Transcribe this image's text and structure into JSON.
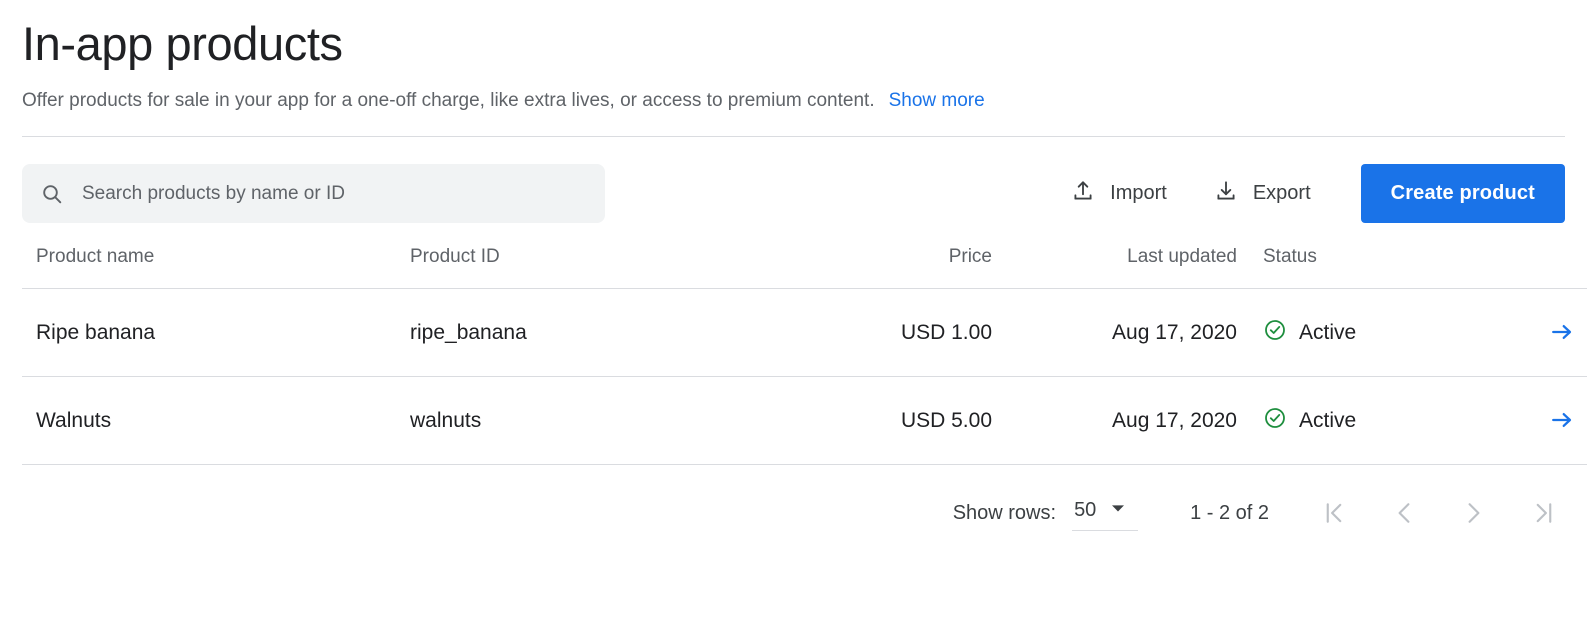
{
  "header": {
    "title": "In-app products",
    "subtitle": "Offer products for sale in your app for a one-off charge, like extra lives, or access to premium content.",
    "show_more_label": "Show more"
  },
  "toolbar": {
    "search_placeholder": "Search products by name or ID",
    "search_value": "",
    "import_label": "Import",
    "export_label": "Export",
    "create_label": "Create product"
  },
  "table": {
    "columns": [
      "Product name",
      "Product ID",
      "Price",
      "Last updated",
      "Status"
    ],
    "rows": [
      {
        "name": "Ripe banana",
        "id": "ripe_banana",
        "price": "USD 1.00",
        "last_updated": "Aug 17, 2020",
        "status": "Active"
      },
      {
        "name": "Walnuts",
        "id": "walnuts",
        "price": "USD 5.00",
        "last_updated": "Aug 17, 2020",
        "status": "Active"
      }
    ]
  },
  "footer": {
    "show_rows_label": "Show rows:",
    "rows_per_page": "50",
    "range": "1 - 2 of 2"
  },
  "colors": {
    "accent_blue": "#1a73e8",
    "status_green": "#1e8e3e",
    "text_primary": "#202124",
    "text_secondary": "#5f6368",
    "divider": "#dadce0",
    "search_background": "#f1f3f4",
    "pager_disabled": "#bdc1c6"
  }
}
